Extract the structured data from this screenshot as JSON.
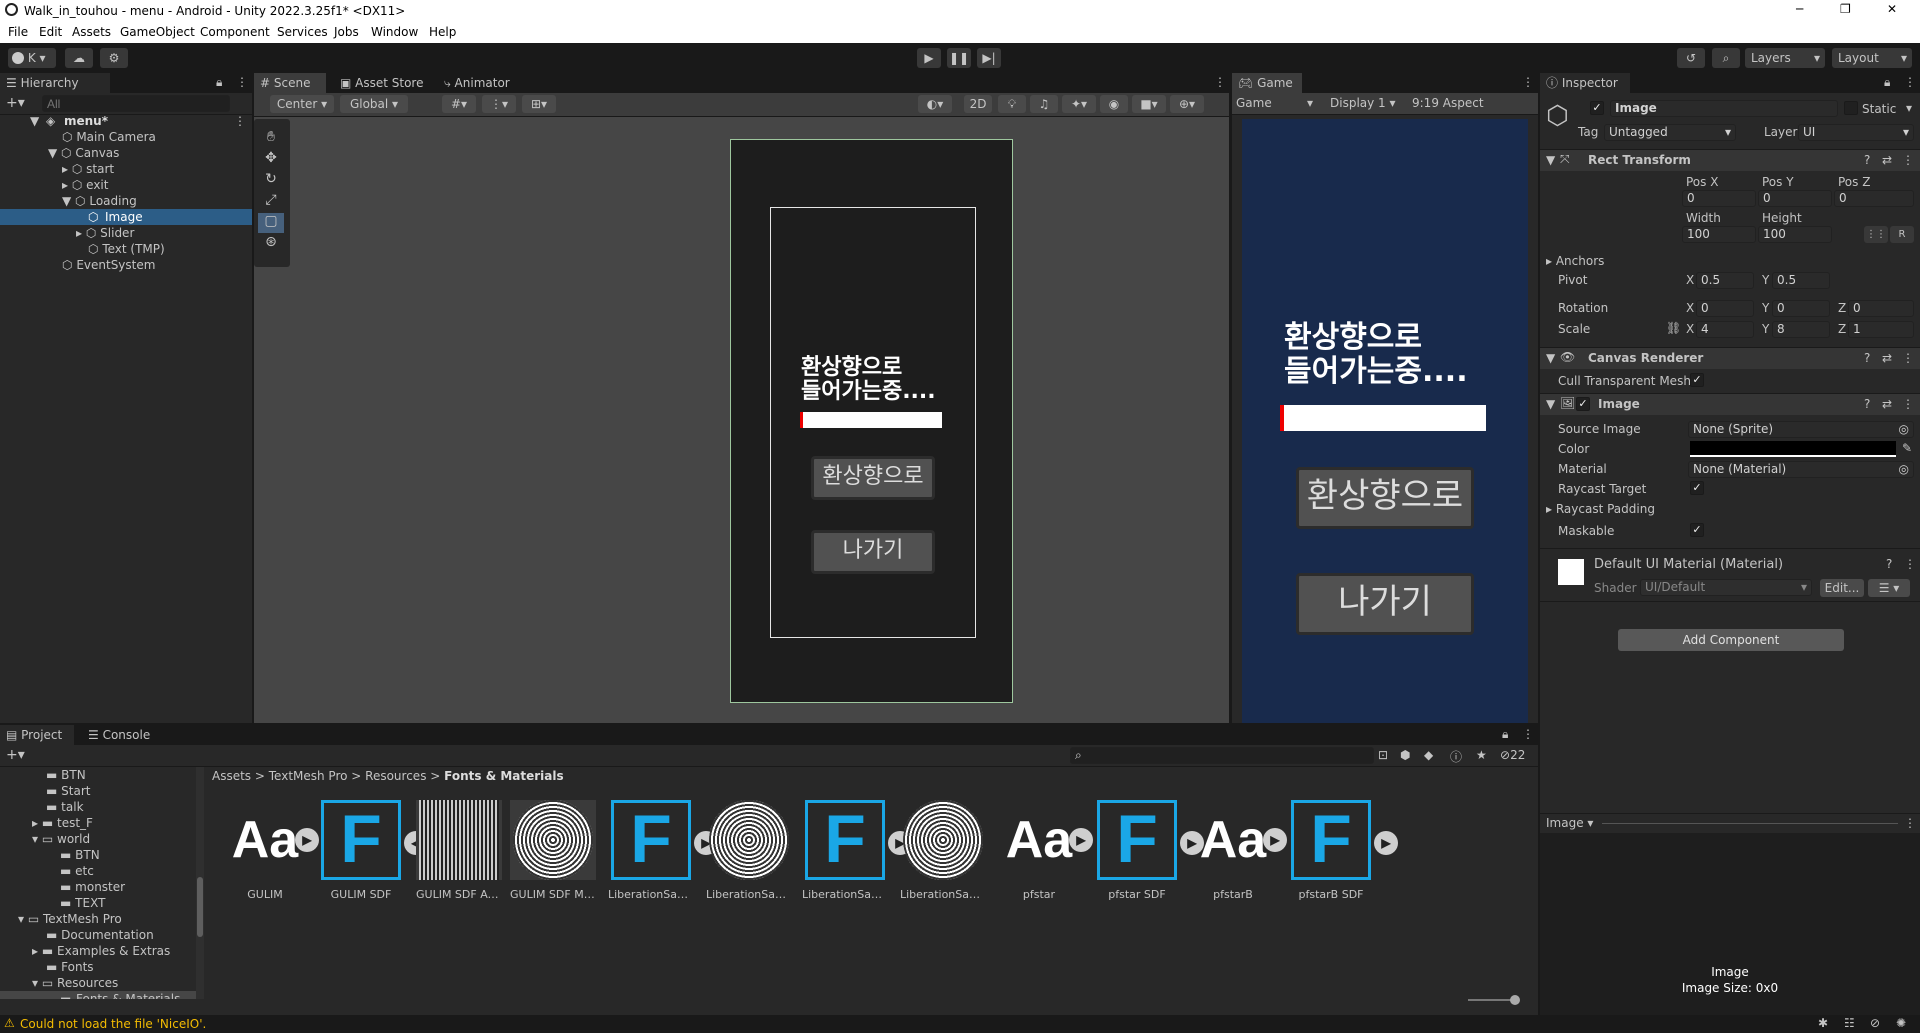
{
  "window": {
    "title": "Walk_in_touhou - menu - Android - Unity 2022.3.25f1* <DX11>",
    "minimize": "─",
    "maximize": "❐",
    "close": "✕"
  },
  "menu": [
    "File",
    "Edit",
    "Assets",
    "GameObject",
    "Component",
    "Services",
    "Jobs",
    "Window",
    "Help"
  ],
  "toolbar": {
    "account": "K",
    "layers": "Layers",
    "layout": "Layout"
  },
  "hierarchy": {
    "tab": "Hierarchy",
    "search_placeholder": "All",
    "scene": "menu*",
    "items": [
      {
        "label": "Main Camera"
      },
      {
        "label": "Canvas"
      },
      {
        "label": "start"
      },
      {
        "label": "exit"
      },
      {
        "label": "Loading"
      },
      {
        "label": "Image"
      },
      {
        "label": "Slider"
      },
      {
        "label": "Text (TMP)"
      },
      {
        "label": "EventSystem"
      }
    ]
  },
  "scene": {
    "tabs": [
      "Scene",
      "Asset Store",
      "Animator"
    ],
    "pivot": "Center",
    "space": "Global",
    "mode2d": "2D",
    "loading_text": "환상향으로\n들어가는중....",
    "button1": "환상향으로",
    "button2": "나가기"
  },
  "game": {
    "tab": "Game",
    "view": "Game",
    "display": "Display 1",
    "aspect": "9:19 Aspect"
  },
  "inspector": {
    "tab": "Inspector",
    "object_name": "Image",
    "static": "Static",
    "tag_label": "Tag",
    "tag": "Untagged",
    "layer_label": "Layer",
    "layer": "UI",
    "rect": {
      "title": "Rect Transform",
      "posx_l": "Pos X",
      "posy_l": "Pos Y",
      "posz_l": "Pos Z",
      "posx": "0",
      "posy": "0",
      "posz": "0",
      "width_l": "Width",
      "height_l": "Height",
      "width": "100",
      "height": "100",
      "anchors": "Anchors",
      "pivot": "Pivot",
      "pivot_x": "0.5",
      "pivot_y": "0.5",
      "rotation": "Rotation",
      "rot_x": "0",
      "rot_y": "0",
      "rot_z": "0",
      "scale": "Scale",
      "scale_x": "4",
      "scale_y": "8",
      "scale_z": "1",
      "x": "X",
      "y": "Y",
      "z": "Z"
    },
    "canvas_renderer": {
      "title": "Canvas Renderer",
      "cull": "Cull Transparent Mesh"
    },
    "image": {
      "title": "Image",
      "source_l": "Source Image",
      "source": "None (Sprite)",
      "color_l": "Color",
      "material_l": "Material",
      "material": "None (Material)",
      "raycast": "Raycast Target",
      "padding": "Raycast Padding",
      "maskable": "Maskable"
    },
    "material": {
      "name": "Default UI Material (Material)",
      "shader_l": "Shader",
      "shader": "UI/Default",
      "edit": "Edit..."
    },
    "add_component": "Add Component",
    "preview": {
      "dropdown": "Image",
      "name": "Image",
      "size": "Image Size: 0x0"
    }
  },
  "project": {
    "tabs": [
      "Project",
      "Console"
    ],
    "breadcrumb": [
      "Assets",
      "TextMesh Pro",
      "Resources",
      "Fonts & Materials"
    ],
    "badge": "22",
    "tree": [
      "BTN",
      "Start",
      "talk",
      "test_F",
      "world",
      "BTN",
      "etc",
      "monster",
      "TEXT",
      "TextMesh Pro",
      "Documentation",
      "Examples & Extras",
      "Fonts",
      "Resources",
      "Fonts & Materials"
    ],
    "assets": [
      "GULIM",
      "GULIM SDF",
      "GULIM SDF Atl...",
      "GULIM SDF Ma...",
      "LiberationSans...",
      "LiberationSans...",
      "LiberationSans...",
      "LiberationSans...",
      "pfstar",
      "pfstar SDF",
      "pfstarB",
      "pfstarB SDF"
    ]
  },
  "status": {
    "warning": "Could not load the file 'NiceIO'."
  },
  "colors": {
    "accent": "#1aa7e6",
    "selection": "#2c5d87",
    "game_bg": "#182a4c",
    "warning": "#f4bc02"
  }
}
